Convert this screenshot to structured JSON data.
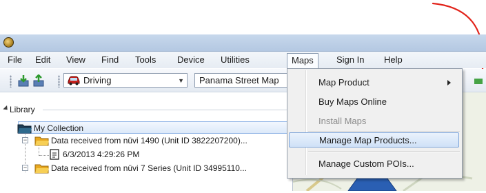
{
  "menubar": {
    "items": [
      "File",
      "Edit",
      "View",
      "Find",
      "Tools",
      "Device",
      "Utilities",
      "Maps",
      "Sign In",
      "Help"
    ],
    "active": "Maps"
  },
  "toolbar": {
    "profile_label": "Driving",
    "map_select": "Panama Street Map"
  },
  "maps_menu": {
    "items": [
      {
        "label": "Map Product",
        "has_submenu": true,
        "enabled": true
      },
      {
        "label": "Buy Maps Online",
        "enabled": true
      },
      {
        "label": "Install Maps",
        "enabled": false
      },
      {
        "label": "Manage Map Products...",
        "enabled": true,
        "highlighted": true
      },
      {
        "label": "Manage Custom POIs...",
        "enabled": true
      }
    ]
  },
  "library": {
    "header": "Library",
    "items": [
      {
        "label": "My Collection",
        "selected": true
      },
      {
        "label": "Data received from nüvi 1490 (Unit ID 3822207200)..."
      },
      {
        "label": "6/3/2013 4:29:26 PM"
      },
      {
        "label": "Data received from nüvi 7 Series (Unit ID 34995110..."
      }
    ]
  },
  "colors": {
    "annotation": "#e2231a",
    "menu_highlight": "#cfe1f7",
    "selection_border": "#8fb4e6"
  },
  "icons": [
    "app-logo-icon",
    "send-to-device-icon",
    "receive-from-device-icon",
    "car-icon",
    "folder-icon",
    "document-icon",
    "submenu-arrow-icon",
    "expander-icon"
  ]
}
